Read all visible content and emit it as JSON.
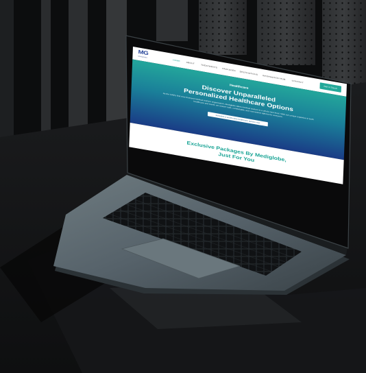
{
  "site": {
    "logo": {
      "mark": "MG",
      "sub": "Mediglobe"
    },
    "nav": [
      {
        "label": "HOME",
        "active": true
      },
      {
        "label": "ABOUT"
      },
      {
        "label": "TREATMENTS"
      },
      {
        "label": "PACKAGES"
      },
      {
        "label": "DESTINATIONS"
      },
      {
        "label": "INFORMATION HUB"
      },
      {
        "label": "CONTACT"
      }
    ],
    "cta": "Get in Touch",
    "hero": {
      "kicker": "Healthcare",
      "title_line1": "Discover Unparalleled",
      "title_line2": "Personalized Healthcare Options",
      "body": "As the UAE's first ever licensed medical tourism organization, Mediglobe takes medical tourism to a whole new level. With our unique expertise in both healthcare and travel, we ensure safe, comfortable, and convenient options for everyone.",
      "button": "Schedule a world-class healthcare options now"
    },
    "section": {
      "title_line1": "Exclusive Packages By Mediglobe,",
      "title_line2": "Just For You"
    }
  },
  "colors": {
    "background": "#0b0c0d",
    "laptop_body": "#5f6b71",
    "screen_bezel": "#0a0a0b",
    "accent": "#1ca596",
    "hero_top": "#23a69b",
    "hero_bottom": "#1a3c86",
    "logo_blue": "#27459a"
  }
}
